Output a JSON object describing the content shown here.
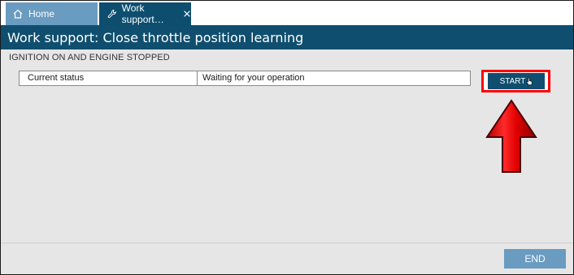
{
  "tabs": [
    {
      "label": "Home",
      "icon": "home-icon",
      "active": false
    },
    {
      "label": "Work support…",
      "icon": "wrench-icon",
      "active": true,
      "closable": true
    }
  ],
  "header": {
    "title": "Work support: Close throttle position learning"
  },
  "content": {
    "condition": "IGNITION ON AND ENGINE STOPPED",
    "status": {
      "label": "Current status",
      "value": "Waiting for your operation"
    }
  },
  "buttons": {
    "start": "START",
    "end": "END"
  },
  "annotation": {
    "highlight_color": "#ff0000",
    "arrow_color": "#e00000",
    "arrow_direction": "up"
  },
  "colors": {
    "header_bg": "#0f4e6e",
    "active_tab": "#0d4e6f",
    "inactive_tab": "#6a9bc0",
    "content_bg": "#e6e6e6"
  }
}
